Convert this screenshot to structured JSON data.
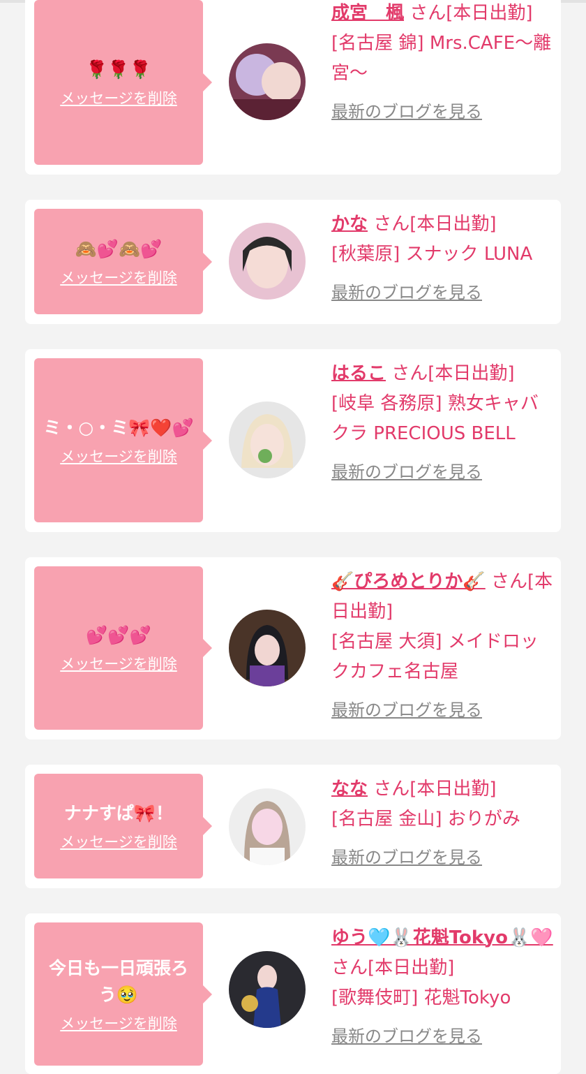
{
  "delete_label": "メッセージを削除",
  "blog_label": "最新のブログを見る",
  "entries": [
    {
      "message": "🌹🌹🌹",
      "name": "成宮　楓",
      "status": "さん[本日出勤]",
      "shop": "[名古屋 錦] Mrs.CAFE～離宮～"
    },
    {
      "message": "🙈💕🙈💕",
      "name": "かな",
      "status": "さん[本日出勤]",
      "shop": "[秋葉原] スナック LUNA"
    },
    {
      "message": "ミ・○・ミ🎀❤️💕",
      "name": "はるこ",
      "status": "さん[本日出勤]",
      "shop": "[岐阜 各務原]  熟女キャバクラ PRECIOUS BELL"
    },
    {
      "message": "💕💕💕",
      "name": "🎸ぴろめとりか🎸",
      "status": "さん[本日出勤]",
      "shop": "[名古屋 大須] メイドロックカフェ名古屋"
    },
    {
      "message": "ナナすぱ🎀！",
      "name": "なな",
      "status": "さん[本日出勤]",
      "shop": "[名古屋 金山] おりがみ"
    },
    {
      "message": "今日も一日頑張ろう🥹",
      "name": "ゆう🩵🐰花魁Tokyo🐰🩷",
      "status": "さん[本日出勤]",
      "shop": "[歌舞伎町] 花魁Tokyo"
    }
  ],
  "colors": {
    "accent": "#e23a6a",
    "bubble": "#f8a2b0",
    "link_gray": "#888888"
  }
}
